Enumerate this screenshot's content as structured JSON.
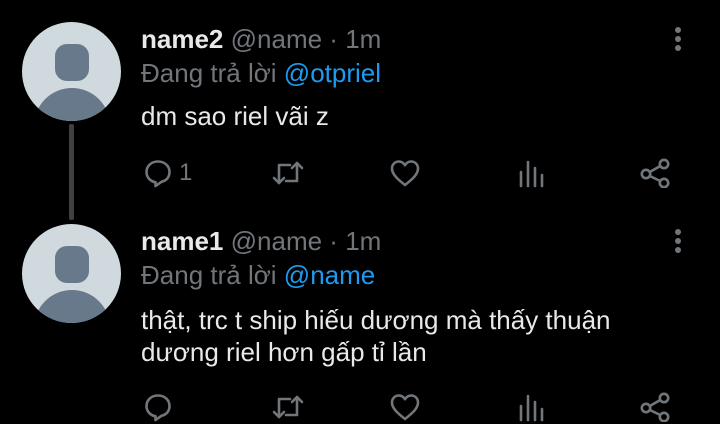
{
  "tweets": [
    {
      "display_name": "name2",
      "handle": "@name",
      "separator": "·",
      "time": "1m",
      "reply_prefix": "Đang trả lời",
      "reply_to": "@otpriel",
      "text_lines": [
        "dm sao riel vãi z"
      ],
      "reply_count": "1",
      "retweet_count": "",
      "like_count": ""
    },
    {
      "display_name": "name1",
      "handle": "@name",
      "separator": "·",
      "time": "1m",
      "reply_prefix": "Đang trả lời",
      "reply_to": "@name",
      "text_lines": [
        "thật, trc t ship hiếu dương mà thấy thuận",
        "dương riel hơn gấp tỉ lần"
      ],
      "reply_count": "",
      "retweet_count": "",
      "like_count": ""
    }
  ],
  "icons": {
    "reply": "reply-icon",
    "retweet": "retweet-icon",
    "like": "heart-icon",
    "views": "views-icon",
    "share": "share-icon",
    "more": "more-options-icon",
    "avatar": "default-avatar"
  },
  "colors": {
    "background": "#000000",
    "text": "#e7e9ea",
    "muted": "#71767b",
    "mention": "#1d9bf0",
    "thread_line": "#3e4144",
    "avatar_bg": "#cfd9de",
    "avatar_fg": "#67798a"
  }
}
